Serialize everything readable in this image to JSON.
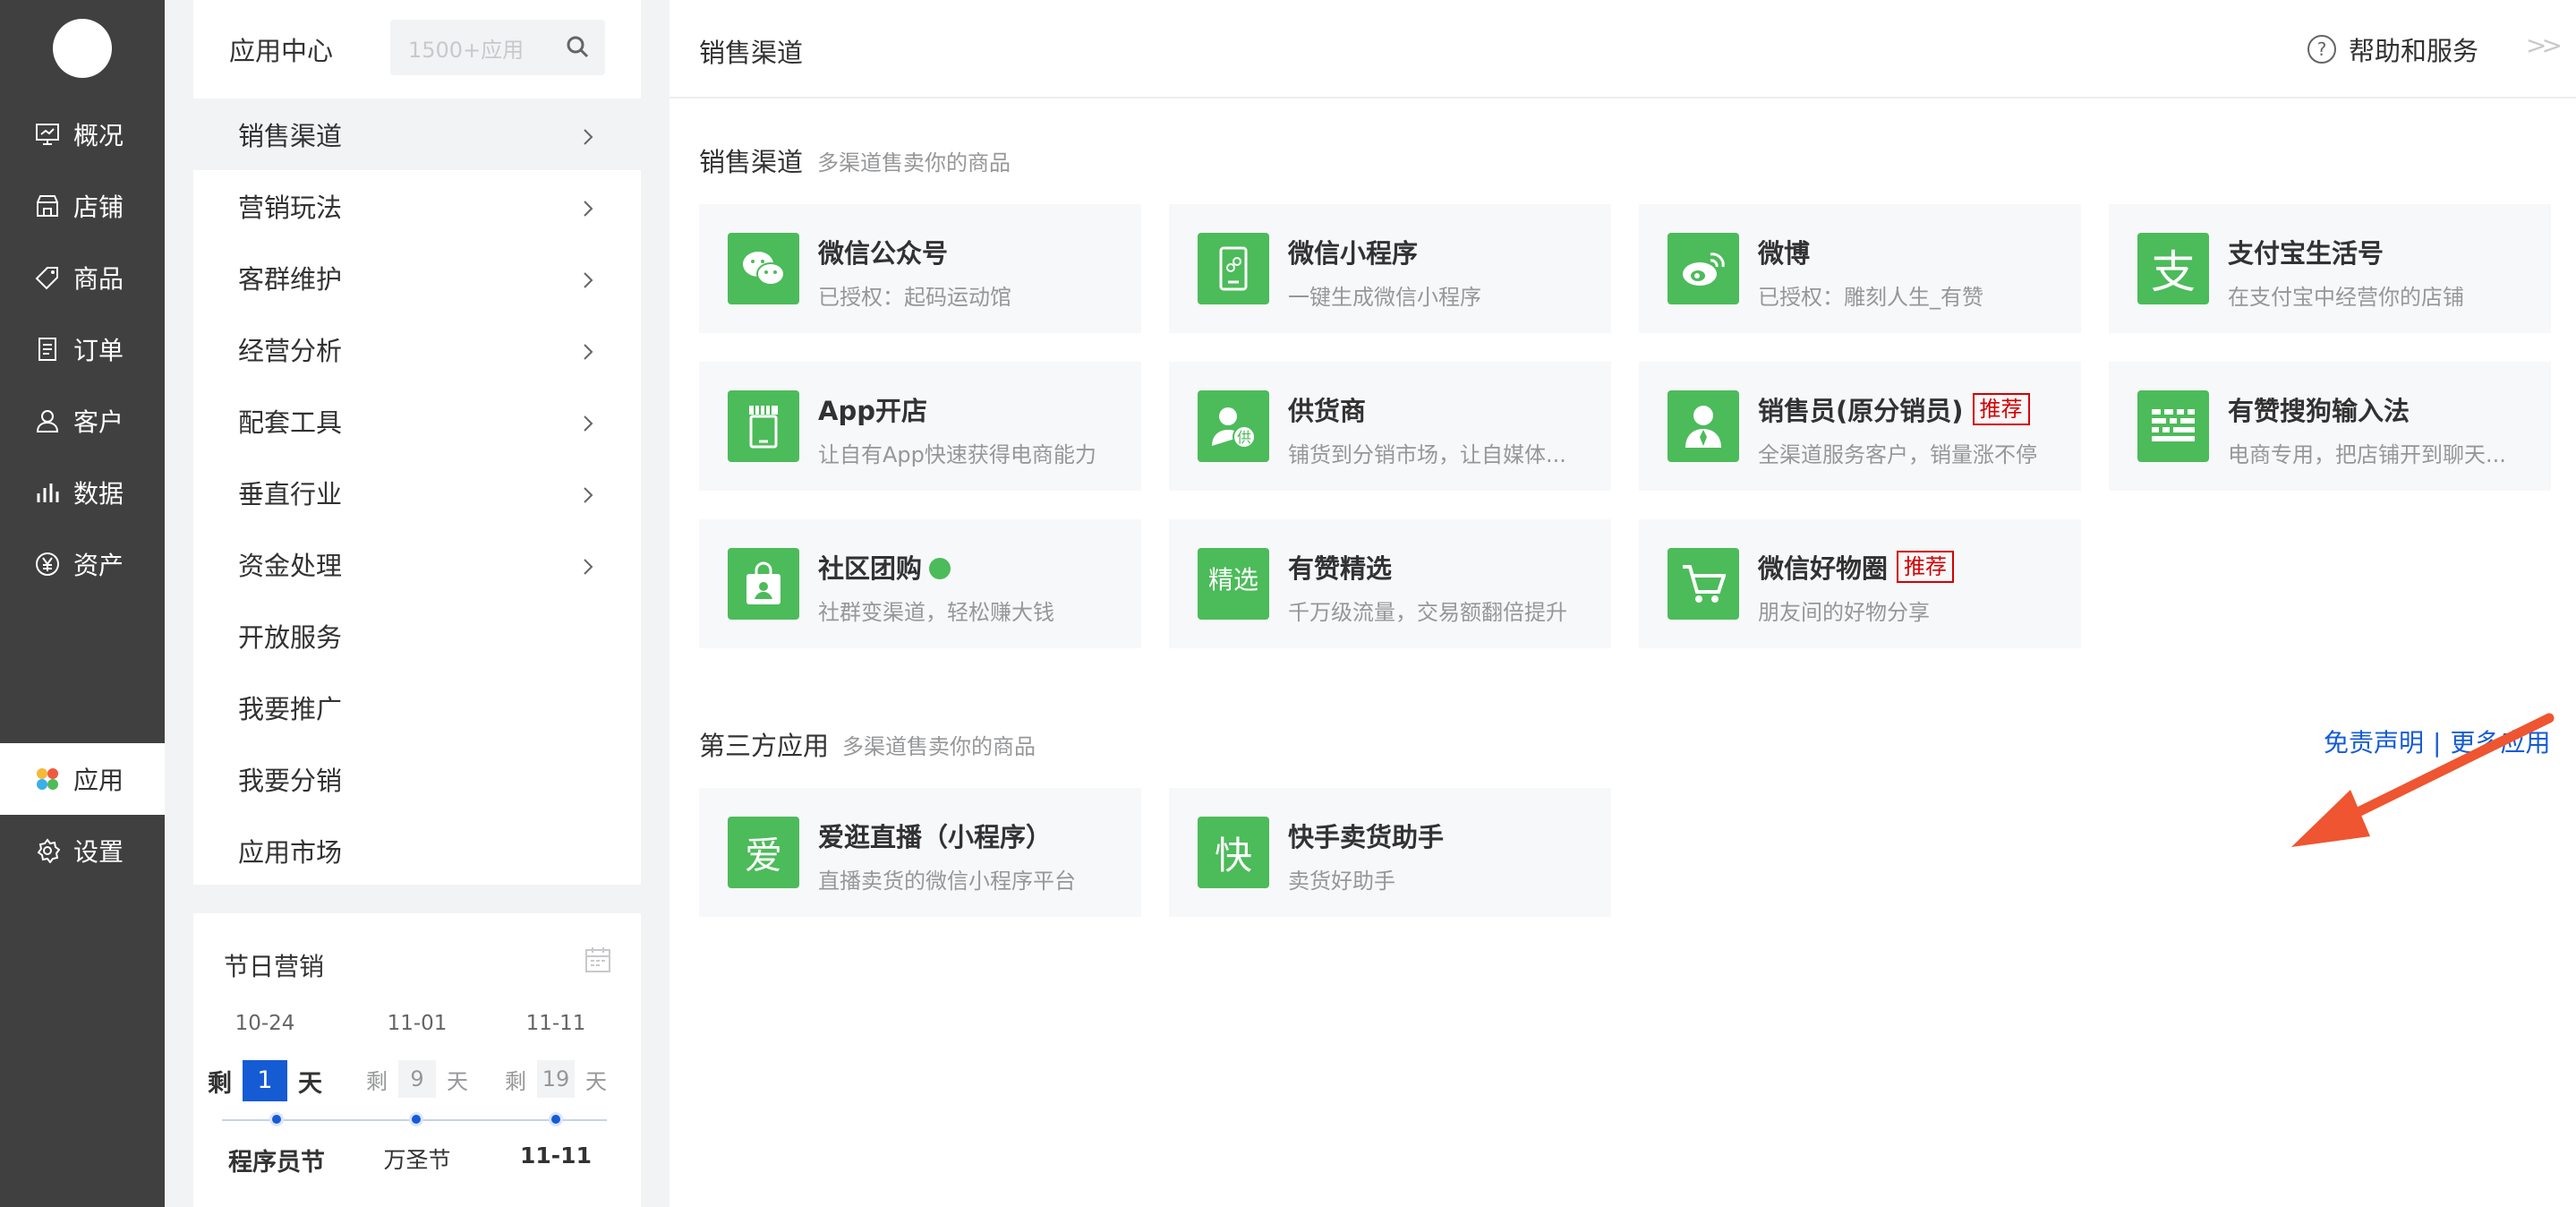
{
  "left_nav": {
    "items": [
      {
        "label": "概况",
        "icon": "monitor-icon"
      },
      {
        "label": "店铺",
        "icon": "store-icon"
      },
      {
        "label": "商品",
        "icon": "tag-icon"
      },
      {
        "label": "订单",
        "icon": "document-icon"
      },
      {
        "label": "客户",
        "icon": "user-icon"
      },
      {
        "label": "数据",
        "icon": "bar-chart-icon"
      },
      {
        "label": "资产",
        "icon": "yen-icon"
      }
    ],
    "apps": {
      "label": "应用",
      "icon": "apps-icon"
    },
    "settings": {
      "label": "设置",
      "icon": "gear-icon"
    }
  },
  "sidebar": {
    "title": "应用中心",
    "search_placeholder": "1500+应用",
    "items": [
      {
        "label": "销售渠道"
      },
      {
        "label": "营销玩法"
      },
      {
        "label": "客群维护"
      },
      {
        "label": "经营分析"
      },
      {
        "label": "配套工具"
      },
      {
        "label": "垂直行业"
      },
      {
        "label": "资金处理"
      },
      {
        "label": "开放服务"
      },
      {
        "label": "我要推广"
      },
      {
        "label": "我要分销"
      },
      {
        "label": "应用市场"
      }
    ]
  },
  "holiday": {
    "title": "节日营销",
    "remain_prefix": "剩",
    "remain_suffix": "天",
    "events": [
      {
        "date": "10-24",
        "days": "1",
        "name": "程序员节"
      },
      {
        "date": "11-01",
        "days": "9",
        "name": "万圣节"
      },
      {
        "date": "11-11",
        "days": "19",
        "name": "11-11"
      }
    ]
  },
  "header": {
    "title": "销售渠道",
    "help_label": "帮助和服务",
    "collapse_label": ">>"
  },
  "sales_section": {
    "title": "销售渠道",
    "subtitle": "多渠道售卖你的商品",
    "cards": [
      {
        "name": "微信公众号",
        "desc": "已授权：起码运动馆",
        "icon": "wechat-icon",
        "icon_text": "",
        "tag": ""
      },
      {
        "name": "微信小程序",
        "desc": "一键生成微信小程序",
        "icon": "mini-program-icon",
        "icon_text": "",
        "tag": ""
      },
      {
        "name": "微博",
        "desc": "已授权：雕刻人生_有赞",
        "icon": "weibo-icon",
        "icon_text": "",
        "tag": ""
      },
      {
        "name": "支付宝生活号",
        "desc": "在支付宝中经营你的店铺",
        "icon": "alipay-icon",
        "icon_text": "支",
        "tag": ""
      },
      {
        "name": "App开店",
        "desc": "让自有App快速获得电商能力",
        "icon": "app-store-icon",
        "icon_text": "",
        "tag": ""
      },
      {
        "name": "供货商",
        "desc": "铺货到分销市场，让自媒体...",
        "icon": "supplier-icon",
        "icon_text": "",
        "tag": ""
      },
      {
        "name": "销售员(原分销员)",
        "desc": "全渠道服务客户，销量涨不停",
        "icon": "salesperson-icon",
        "icon_text": "",
        "tag": "推荐"
      },
      {
        "name": "有赞搜狗输入法",
        "desc": "电商专用，把店铺开到聊天...",
        "icon": "keyboard-icon",
        "icon_text": "",
        "tag": ""
      },
      {
        "name": "社区团购",
        "desc": "社群变渠道，轻松赚大钱",
        "icon": "shopping-bag-icon",
        "icon_text": "",
        "tag": ""
      },
      {
        "name": "有赞精选",
        "desc": "千万级流量，交易额翻倍提升",
        "icon": "jingxuan-icon",
        "icon_text": "精选",
        "tag": ""
      },
      {
        "name": "微信好物圈",
        "desc": "朋友间的好物分享",
        "icon": "cart-icon",
        "icon_text": "",
        "tag": "推荐"
      }
    ]
  },
  "third_section": {
    "title": "第三方应用",
    "subtitle": "多渠道售卖你的商品",
    "disclaimer_label": "免责声明",
    "separator": "|",
    "more_label": "更多应用",
    "cards": [
      {
        "name": "爱逛直播（小程序）",
        "desc": "直播卖货的微信小程序平台",
        "icon": "aiguang-icon",
        "icon_text": "爱"
      },
      {
        "name": "快手卖货助手",
        "desc": "卖货好助手",
        "icon": "kuaishou-icon",
        "icon_text": "快"
      }
    ]
  },
  "colors": {
    "nav_bg": "#404040",
    "accent": "#155bd4",
    "icon_green": "#4cbb5a",
    "tag_red": "#d40000",
    "arrow": "#ee5530"
  }
}
